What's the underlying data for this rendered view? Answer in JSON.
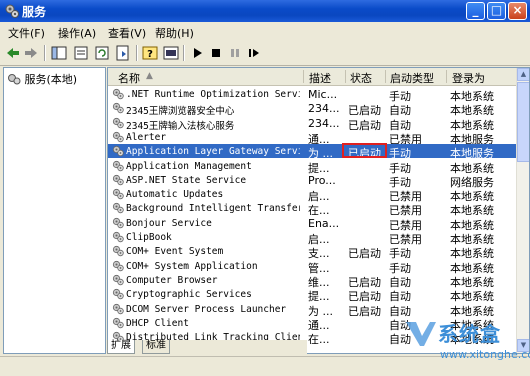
{
  "window": {
    "title": "服务"
  },
  "menu": [
    "文件(F)",
    "操作(A)",
    "查看(V)",
    "帮助(H)"
  ],
  "tree": {
    "label": "服务(本地)"
  },
  "columns": [
    "名称",
    "描述",
    "状态",
    "启动类型",
    "登录为"
  ],
  "services": [
    {
      "name": ".NET Runtime Optimization Servi...",
      "desc": "Mic...",
      "status": "",
      "startup": "手动",
      "logon": "本地系统"
    },
    {
      "name": "2345王牌浏览器安全中心",
      "desc": "234...",
      "status": "已启动",
      "startup": "自动",
      "logon": "本地系统"
    },
    {
      "name": "2345王牌输入法核心服务",
      "desc": "234...",
      "status": "已启动",
      "startup": "自动",
      "logon": "本地系统"
    },
    {
      "name": "Alerter",
      "desc": "通...",
      "status": "",
      "startup": "已禁用",
      "logon": "本地服务"
    },
    {
      "name": "Application Layer Gateway Service",
      "desc": "为 ...",
      "status": "已启动",
      "startup": "手动",
      "logon": "本地服务"
    },
    {
      "name": "Application Management",
      "desc": "提...",
      "status": "",
      "startup": "手动",
      "logon": "本地系统"
    },
    {
      "name": "ASP.NET State Service",
      "desc": "Pro...",
      "status": "",
      "startup": "手动",
      "logon": "网络服务"
    },
    {
      "name": "Automatic Updates",
      "desc": "启...",
      "status": "",
      "startup": "已禁用",
      "logon": "本地系统"
    },
    {
      "name": "Background Intelligent Transfer...",
      "desc": "在...",
      "status": "",
      "startup": "已禁用",
      "logon": "本地系统"
    },
    {
      "name": "Bonjour Service",
      "desc": "Ena...",
      "status": "",
      "startup": "已禁用",
      "logon": "本地系统"
    },
    {
      "name": "ClipBook",
      "desc": "启...",
      "status": "",
      "startup": "已禁用",
      "logon": "本地系统"
    },
    {
      "name": "COM+ Event System",
      "desc": "支...",
      "status": "已启动",
      "startup": "手动",
      "logon": "本地系统"
    },
    {
      "name": "COM+ System Application",
      "desc": "管...",
      "status": "",
      "startup": "手动",
      "logon": "本地系统"
    },
    {
      "name": "Computer Browser",
      "desc": "维...",
      "status": "已启动",
      "startup": "自动",
      "logon": "本地系统"
    },
    {
      "name": "Cryptographic Services",
      "desc": "提...",
      "status": "已启动",
      "startup": "自动",
      "logon": "本地系统"
    },
    {
      "name": "DCOM Server Process Launcher",
      "desc": "为 ...",
      "status": "已启动",
      "startup": "自动",
      "logon": "本地系统"
    },
    {
      "name": "DHCP Client",
      "desc": "通...",
      "status": "",
      "startup": "自动",
      "logon": "本地系统"
    },
    {
      "name": "Distributed Link Tracking Client",
      "desc": "在...",
      "status": "",
      "startup": "自动",
      "logon": "本地系统"
    }
  ],
  "selected_index": 4,
  "tabs": [
    "扩展",
    "标准"
  ],
  "watermark": {
    "text": "系统盒",
    "url": "www.xitonghe.com"
  },
  "colors": {
    "selection": "#316ac5",
    "titlebar": "#0a4bc8",
    "highlight_box": "#e02020"
  }
}
